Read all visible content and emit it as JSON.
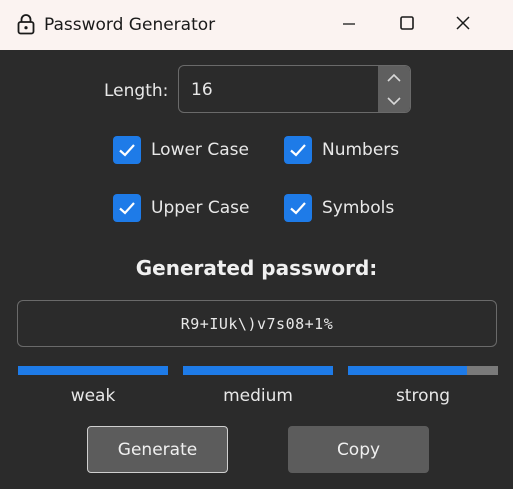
{
  "window": {
    "title": "Password Generator",
    "icons": {
      "app": "lock-icon",
      "minimize": "minimize-icon",
      "maximize": "maximize-icon",
      "close": "close-icon"
    }
  },
  "colors": {
    "background": "#2b2b2b",
    "titlebar": "#fbf3f1",
    "accent": "#1e7be8",
    "button": "#5c5c5c",
    "field_border": "#6a6a6a"
  },
  "length": {
    "label": "Length:",
    "value": "16",
    "icons": {
      "up": "chevron-up-icon",
      "down": "chevron-down-icon"
    }
  },
  "options": {
    "lower_case": {
      "label": "Lower Case",
      "checked": true
    },
    "numbers": {
      "label": "Numbers",
      "checked": true
    },
    "upper_case": {
      "label": "Upper Case",
      "checked": true
    },
    "symbols": {
      "label": "Symbols",
      "checked": true
    }
  },
  "password": {
    "heading": "Generated password:",
    "value": "R9+IUk\\)v7s08+1%"
  },
  "strength": {
    "weak": {
      "label": "weak",
      "level": 1.0
    },
    "medium": {
      "label": "medium",
      "level": 1.0
    },
    "strong": {
      "label": "strong",
      "level": 0.79
    }
  },
  "buttons": {
    "generate": "Generate",
    "copy": "Copy"
  }
}
